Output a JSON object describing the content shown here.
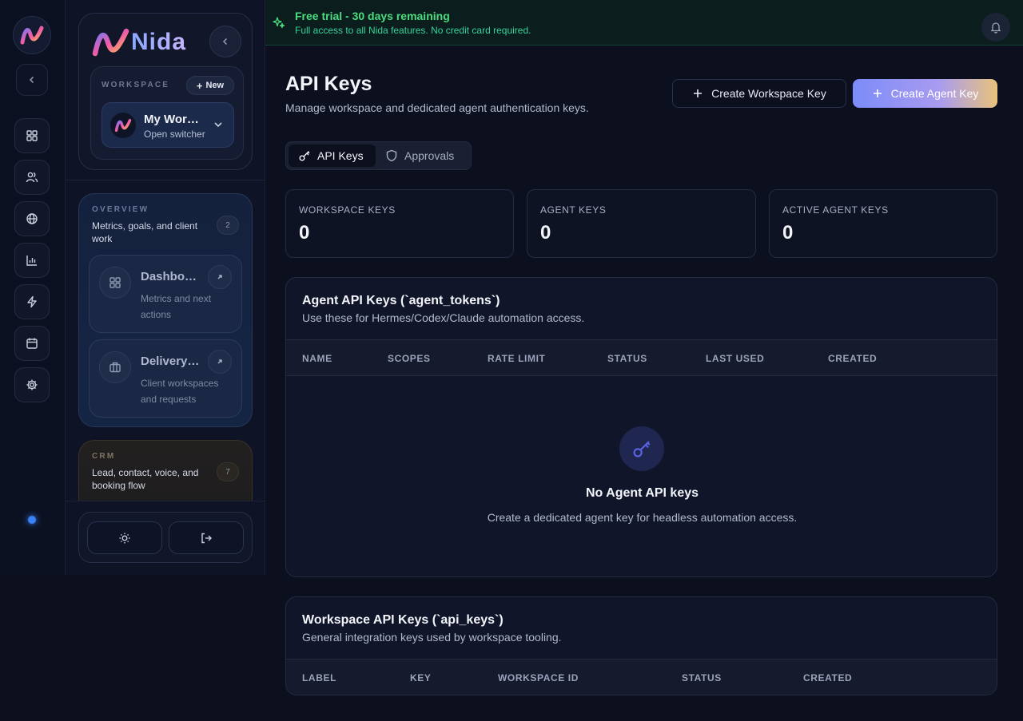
{
  "brand": {
    "name": "Nida"
  },
  "workspace": {
    "label": "WORKSPACE",
    "new_label": "New",
    "name": "My Workspace",
    "switcher_label": "Open switcher"
  },
  "rail": {
    "items": [
      "dashboard-icon",
      "users-icon",
      "globe-icon",
      "bar-chart-icon",
      "lightning-icon",
      "calendar-icon",
      "settings-icon"
    ]
  },
  "sidebar": {
    "overview": {
      "label": "OVERVIEW",
      "description": "Metrics, goals, and client work",
      "count": "2",
      "items": [
        {
          "title": "Dashboard",
          "subtitle": "Metrics and next actions"
        },
        {
          "title": "Delivery Hub",
          "subtitle": "Client workspaces and requests"
        }
      ]
    },
    "crm": {
      "label": "CRM",
      "description": "Lead, contact, voice, and booking flow",
      "count": "7"
    }
  },
  "banner": {
    "title": "Free trial - 30 days remaining",
    "subtitle": "Full access to all Nida features. No credit card required."
  },
  "page": {
    "title": "API Keys",
    "subtitle": "Manage workspace and dedicated agent authentication keys.",
    "create_workspace_key": "Create Workspace Key",
    "create_agent_key": "Create Agent Key"
  },
  "tabs": [
    {
      "label": "API Keys",
      "active": true
    },
    {
      "label": "Approvals",
      "active": false
    }
  ],
  "stats": [
    {
      "label": "WORKSPACE KEYS",
      "value": "0"
    },
    {
      "label": "AGENT KEYS",
      "value": "0"
    },
    {
      "label": "ACTIVE AGENT KEYS",
      "value": "0"
    }
  ],
  "agent_panel": {
    "title": "Agent API Keys (`agent_tokens`)",
    "subtitle": "Use these for Hermes/Codex/Claude automation access.",
    "columns": [
      "NAME",
      "SCOPES",
      "RATE LIMIT",
      "STATUS",
      "LAST USED",
      "CREATED"
    ],
    "empty_title": "No Agent API keys",
    "empty_subtitle": "Create a dedicated agent key for headless automation access."
  },
  "workspace_panel": {
    "title": "Workspace API Keys (`api_keys`)",
    "subtitle": "General integration keys used by workspace tooling.",
    "columns": [
      "LABEL",
      "KEY",
      "WORKSPACE ID",
      "STATUS",
      "CREATED"
    ]
  },
  "colors": {
    "accent": "#7c8cf8",
    "banner_text": "#4ade80",
    "background": "#0b0f1e"
  }
}
